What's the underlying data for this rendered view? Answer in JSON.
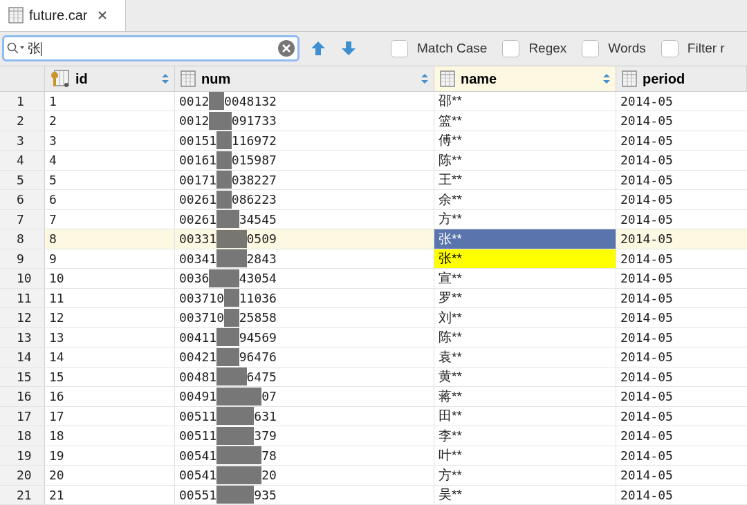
{
  "tab": {
    "title": "future.car"
  },
  "search": {
    "value": "张"
  },
  "options": [
    {
      "label": "Match Case",
      "checked": false
    },
    {
      "label": "Regex",
      "checked": false
    },
    {
      "label": "Words",
      "checked": false
    },
    {
      "label": "Filter r",
      "checked": false
    }
  ],
  "columns": [
    {
      "label": "id",
      "key": true,
      "sortable": true,
      "selected": false
    },
    {
      "label": "num",
      "key": false,
      "sortable": true,
      "selected": false
    },
    {
      "label": "name",
      "key": false,
      "sortable": true,
      "selected": true
    },
    {
      "label": "period",
      "key": false,
      "sortable": false,
      "selected": false
    }
  ],
  "rows": [
    {
      "row": "1",
      "id": "1",
      "num_prefix": "0012",
      "num_suffix": "0048132",
      "name": "邵**",
      "period": "2014-05",
      "selected": false,
      "match": false
    },
    {
      "row": "2",
      "id": "2",
      "num_prefix": "0012",
      "num_suffix": "091733",
      "name": "篮**",
      "period": "2014-05",
      "selected": false,
      "match": false
    },
    {
      "row": "3",
      "id": "3",
      "num_prefix": "00151",
      "num_suffix": "116972",
      "name": "傅**",
      "period": "2014-05",
      "selected": false,
      "match": false
    },
    {
      "row": "4",
      "id": "4",
      "num_prefix": "00161",
      "num_suffix": "015987",
      "name": "陈**",
      "period": "2014-05",
      "selected": false,
      "match": false
    },
    {
      "row": "5",
      "id": "5",
      "num_prefix": "00171",
      "num_suffix": "038227",
      "name": "王**",
      "period": "2014-05",
      "selected": false,
      "match": false
    },
    {
      "row": "6",
      "id": "6",
      "num_prefix": "00261",
      "num_suffix": "086223",
      "name": "余**",
      "period": "2014-05",
      "selected": false,
      "match": false
    },
    {
      "row": "7",
      "id": "7",
      "num_prefix": "00261",
      "num_suffix": "34545",
      "name": "方**",
      "period": "2014-05",
      "selected": false,
      "match": false
    },
    {
      "row": "8",
      "id": "8",
      "num_prefix": "00331",
      "num_suffix": "0509",
      "name": "张**",
      "period": "2014-05",
      "selected": true,
      "match": true
    },
    {
      "row": "9",
      "id": "9",
      "num_prefix": "00341",
      "num_suffix": "2843",
      "name": "张**",
      "period": "2014-05",
      "selected": false,
      "match": true
    },
    {
      "row": "10",
      "id": "10",
      "num_prefix": "0036",
      "num_suffix": "43054",
      "name": "宣**",
      "period": "2014-05",
      "selected": false,
      "match": false
    },
    {
      "row": "11",
      "id": "11",
      "num_prefix": "003710",
      "num_suffix": "11036",
      "name": "罗**",
      "period": "2014-05",
      "selected": false,
      "match": false
    },
    {
      "row": "12",
      "id": "12",
      "num_prefix": "003710",
      "num_suffix": "25858",
      "name": "刘**",
      "period": "2014-05",
      "selected": false,
      "match": false
    },
    {
      "row": "13",
      "id": "13",
      "num_prefix": "00411",
      "num_suffix": "94569",
      "name": "陈**",
      "period": "2014-05",
      "selected": false,
      "match": false
    },
    {
      "row": "14",
      "id": "14",
      "num_prefix": "00421",
      "num_suffix": "96476",
      "name": "袁**",
      "period": "2014-05",
      "selected": false,
      "match": false
    },
    {
      "row": "15",
      "id": "15",
      "num_prefix": "00481",
      "num_suffix": "6475",
      "name": "黄**",
      "period": "2014-05",
      "selected": false,
      "match": false
    },
    {
      "row": "16",
      "id": "16",
      "num_prefix": "00491",
      "num_suffix": "07",
      "name": "蒋**",
      "period": "2014-05",
      "selected": false,
      "match": false
    },
    {
      "row": "17",
      "id": "17",
      "num_prefix": "00511",
      "num_suffix": "631",
      "name": "田**",
      "period": "2014-05",
      "selected": false,
      "match": false
    },
    {
      "row": "18",
      "id": "18",
      "num_prefix": "00511",
      "num_suffix": "379",
      "name": "李**",
      "period": "2014-05",
      "selected": false,
      "match": false
    },
    {
      "row": "19",
      "id": "19",
      "num_prefix": "00541",
      "num_suffix": "78",
      "name": "叶**",
      "period": "2014-05",
      "selected": false,
      "match": false
    },
    {
      "row": "20",
      "id": "20",
      "num_prefix": "00541",
      "num_suffix": "20",
      "name": "方**",
      "period": "2014-05",
      "selected": false,
      "match": false
    },
    {
      "row": "21",
      "id": "21",
      "num_prefix": "00551",
      "num_suffix": "935",
      "name": "吴**",
      "period": "2014-05",
      "selected": false,
      "match": false
    }
  ]
}
